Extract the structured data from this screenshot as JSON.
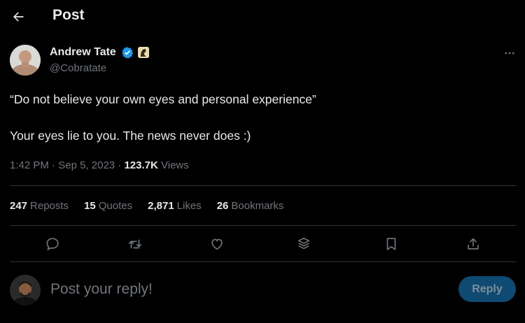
{
  "header": {
    "title": "Post",
    "back_icon": "arrow-left-icon"
  },
  "author": {
    "name": "Andrew Tate",
    "handle": "@Cobratate",
    "verified_color": "#1d9bf0"
  },
  "post": {
    "line1": "“Do not believe your own eyes and personal experience”",
    "line2": "Your eyes lie to you. The news never does :)",
    "time": "1:42 PM",
    "date": "Sep 5, 2023",
    "views_count": "123.7K",
    "views_label": "Views"
  },
  "stats": [
    {
      "value": "247",
      "label": "Reposts"
    },
    {
      "value": "15",
      "label": "Quotes"
    },
    {
      "value": "2,871",
      "label": "Likes"
    },
    {
      "value": "26",
      "label": "Bookmarks"
    }
  ],
  "actions": [
    "reply-icon",
    "repost-icon",
    "like-icon",
    "grok-icon",
    "bookmark-icon",
    "share-icon"
  ],
  "reply": {
    "placeholder": "Post your reply!",
    "button_label": "Reply"
  },
  "colors": {
    "background": "#000000",
    "text": "#e7e9ea",
    "muted": "#71767b",
    "divider": "#2f3336",
    "reply_button": "#0e4a71"
  }
}
